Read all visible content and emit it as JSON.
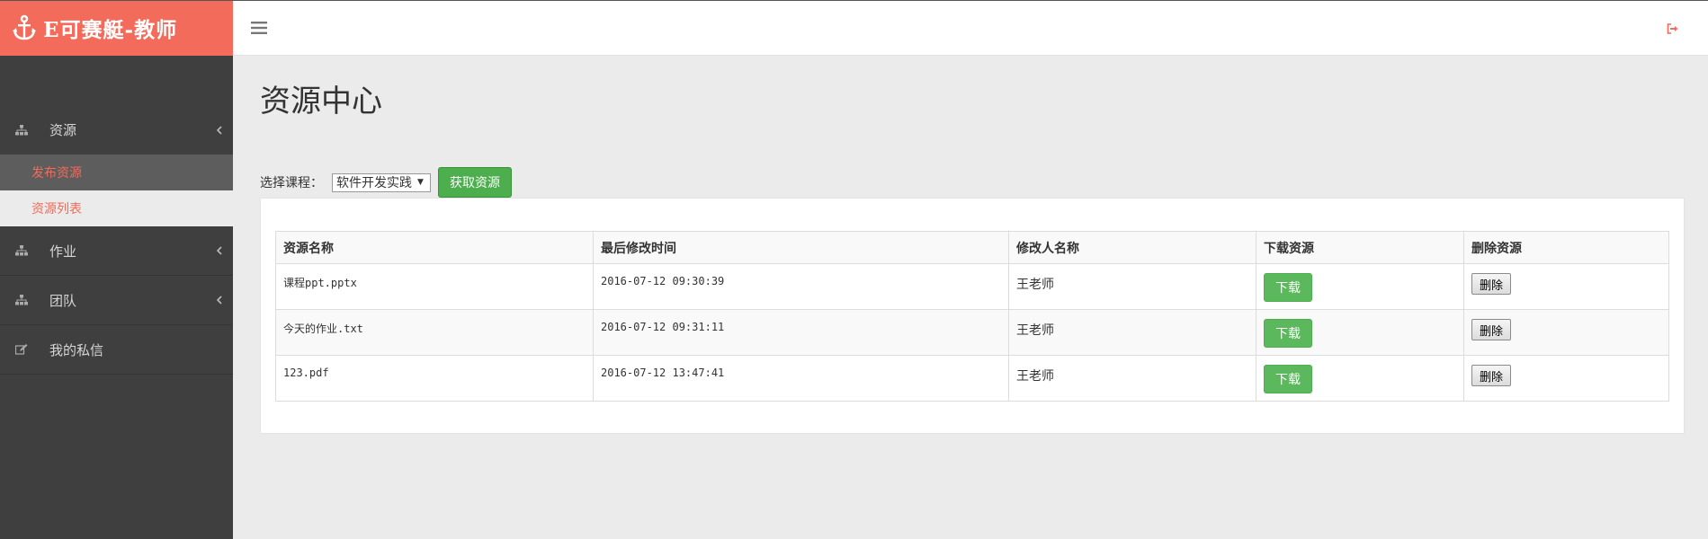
{
  "app": {
    "brand": "E可赛艇-教师"
  },
  "sidebar": {
    "items": [
      {
        "label": "资源",
        "icon": "sitemap-icon",
        "children": [
          {
            "label": "发布资源"
          },
          {
            "label": "资源列表"
          }
        ]
      },
      {
        "label": "作业",
        "icon": "sitemap-icon"
      },
      {
        "label": "团队",
        "icon": "sitemap-icon"
      },
      {
        "label": "我的私信",
        "icon": "edit-icon"
      }
    ]
  },
  "header": {
    "menu_icon": "menu-icon",
    "logout_icon": "sign-out-icon"
  },
  "main": {
    "title": "资源中心",
    "course_label": "选择课程：",
    "course_selected": "软件开发实践",
    "fetch_button": "获取资源",
    "table": {
      "headers": [
        "资源名称",
        "最后修改时间",
        "修改人名称",
        "下载资源",
        "删除资源"
      ],
      "rows": [
        {
          "name": "课程ppt.pptx",
          "modified": "2016-07-12 09:30:39",
          "modifier": "王老师",
          "download": "下载",
          "delete": "删除"
        },
        {
          "name": "今天的作业.txt",
          "modified": "2016-07-12 09:31:11",
          "modifier": "王老师",
          "download": "下载",
          "delete": "删除"
        },
        {
          "name": "123.pdf",
          "modified": "2016-07-12 13:47:41",
          "modifier": "王老师",
          "download": "下载",
          "delete": "删除"
        }
      ]
    }
  },
  "colors": {
    "brand": "#f26b5b",
    "sidebar": "#3f3f3f",
    "success": "#5cb85c"
  }
}
